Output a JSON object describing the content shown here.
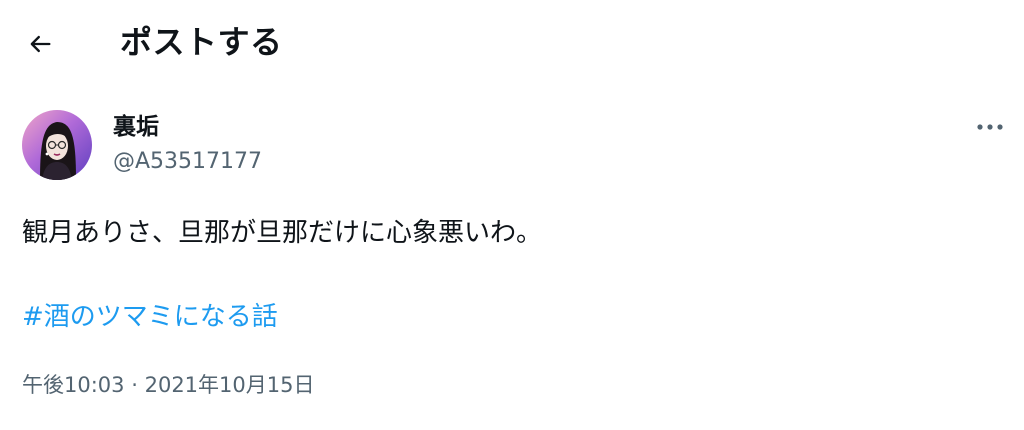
{
  "header": {
    "back_icon": "arrow-left-icon",
    "title": "ポストする"
  },
  "author": {
    "avatar_icon": "user-avatar",
    "name": "裏垢",
    "handle": "@A53517177"
  },
  "post": {
    "text": "観月ありさ、旦那が旦那だけに心象悪いわ。",
    "hashtag": "#酒のツマミになる話"
  },
  "meta": {
    "time": "午後10:03",
    "separator": "·",
    "date": "2021年10月15日"
  },
  "actions": {
    "more_icon": "more-horizontal-icon"
  },
  "colors": {
    "text": "#0f1419",
    "secondary": "#536471",
    "link": "#1d9bf0"
  }
}
